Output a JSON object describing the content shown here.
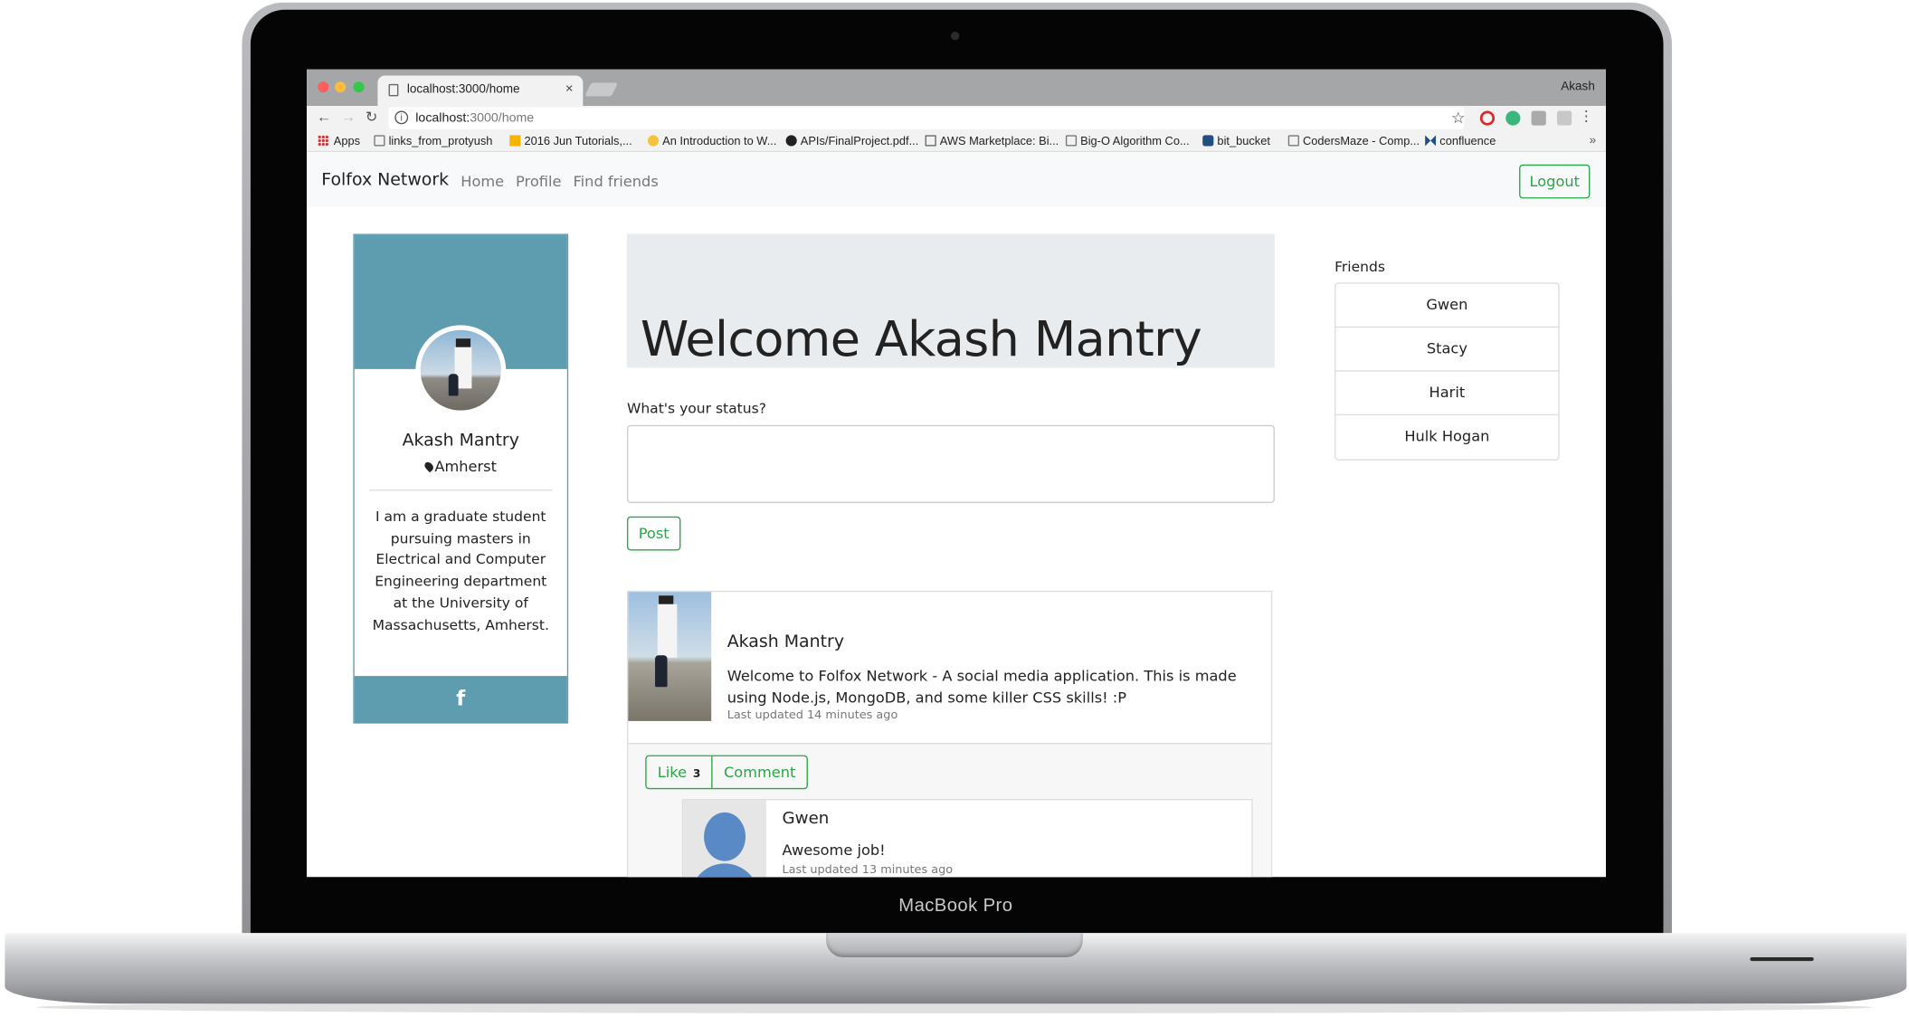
{
  "device": {
    "label": "MacBook Pro"
  },
  "browser": {
    "tab_title": "localhost:3000/home",
    "user_name": "Akash",
    "url_host": "localhost:",
    "url_path": "3000/home",
    "bookmarks": [
      "Apps",
      "links_from_protyush",
      "2016 Jun Tutorials,...",
      "An Introduction to W...",
      "APIs/FinalProject.pdf...",
      "AWS Marketplace: Bi...",
      "Big-O Algorithm Co...",
      "bit_bucket",
      "CodersMaze - Comp...",
      "confluence"
    ],
    "bookmarks_more": "»"
  },
  "navbar": {
    "brand": "Folfox Network",
    "links": [
      "Home",
      "Profile",
      "Find friends"
    ],
    "logout": "Logout"
  },
  "profile": {
    "name": "Akash Mantry",
    "location": "Amherst",
    "bio": "I am a graduate student pursuing masters in Electrical and Computer Engineering department at the University of Massachusetts, Amherst.",
    "social_icon": "facebook-icon",
    "social_glyph": "f"
  },
  "welcome": {
    "heading": "Welcome Akash Mantry"
  },
  "status": {
    "label": "What's your status?",
    "value": "",
    "post_button": "Post"
  },
  "post": {
    "author": "Akash Mantry",
    "text": "Welcome to Folfox Network - A social media application. This is made using Node.js, MongoDB, and some killer CSS skills! :P",
    "time": "Last updated 14 minutes ago",
    "like_label": "Like",
    "like_count": "3",
    "comment_label": "Comment"
  },
  "comment": {
    "author": "Gwen",
    "text": "Awesome job!",
    "time": "Last updated 13 minutes ago"
  },
  "friends": {
    "title": "Friends",
    "list": [
      "Gwen",
      "Stacy",
      "Harit",
      "Hulk Hogan"
    ]
  },
  "colors": {
    "accent_green": "#28a745",
    "card_teal": "#5e9cb0",
    "jumbotron": "#e9ecef"
  }
}
